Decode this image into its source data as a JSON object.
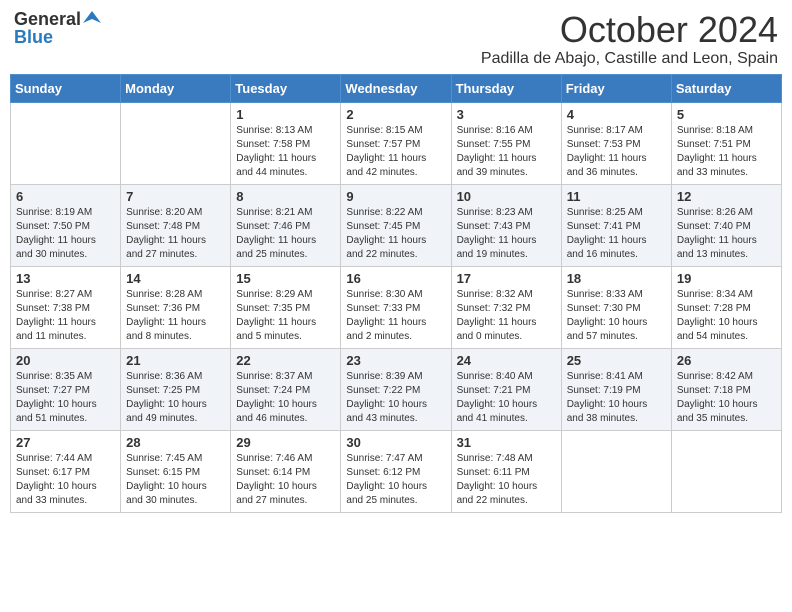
{
  "header": {
    "logo_general": "General",
    "logo_blue": "Blue",
    "month_title": "October 2024",
    "location": "Padilla de Abajo, Castille and Leon, Spain"
  },
  "days_of_week": [
    "Sunday",
    "Monday",
    "Tuesday",
    "Wednesday",
    "Thursday",
    "Friday",
    "Saturday"
  ],
  "weeks": [
    [
      {
        "day": "",
        "text": ""
      },
      {
        "day": "",
        "text": ""
      },
      {
        "day": "1",
        "text": "Sunrise: 8:13 AM\nSunset: 7:58 PM\nDaylight: 11 hours and 44 minutes."
      },
      {
        "day": "2",
        "text": "Sunrise: 8:15 AM\nSunset: 7:57 PM\nDaylight: 11 hours and 42 minutes."
      },
      {
        "day": "3",
        "text": "Sunrise: 8:16 AM\nSunset: 7:55 PM\nDaylight: 11 hours and 39 minutes."
      },
      {
        "day": "4",
        "text": "Sunrise: 8:17 AM\nSunset: 7:53 PM\nDaylight: 11 hours and 36 minutes."
      },
      {
        "day": "5",
        "text": "Sunrise: 8:18 AM\nSunset: 7:51 PM\nDaylight: 11 hours and 33 minutes."
      }
    ],
    [
      {
        "day": "6",
        "text": "Sunrise: 8:19 AM\nSunset: 7:50 PM\nDaylight: 11 hours and 30 minutes."
      },
      {
        "day": "7",
        "text": "Sunrise: 8:20 AM\nSunset: 7:48 PM\nDaylight: 11 hours and 27 minutes."
      },
      {
        "day": "8",
        "text": "Sunrise: 8:21 AM\nSunset: 7:46 PM\nDaylight: 11 hours and 25 minutes."
      },
      {
        "day": "9",
        "text": "Sunrise: 8:22 AM\nSunset: 7:45 PM\nDaylight: 11 hours and 22 minutes."
      },
      {
        "day": "10",
        "text": "Sunrise: 8:23 AM\nSunset: 7:43 PM\nDaylight: 11 hours and 19 minutes."
      },
      {
        "day": "11",
        "text": "Sunrise: 8:25 AM\nSunset: 7:41 PM\nDaylight: 11 hours and 16 minutes."
      },
      {
        "day": "12",
        "text": "Sunrise: 8:26 AM\nSunset: 7:40 PM\nDaylight: 11 hours and 13 minutes."
      }
    ],
    [
      {
        "day": "13",
        "text": "Sunrise: 8:27 AM\nSunset: 7:38 PM\nDaylight: 11 hours and 11 minutes."
      },
      {
        "day": "14",
        "text": "Sunrise: 8:28 AM\nSunset: 7:36 PM\nDaylight: 11 hours and 8 minutes."
      },
      {
        "day": "15",
        "text": "Sunrise: 8:29 AM\nSunset: 7:35 PM\nDaylight: 11 hours and 5 minutes."
      },
      {
        "day": "16",
        "text": "Sunrise: 8:30 AM\nSunset: 7:33 PM\nDaylight: 11 hours and 2 minutes."
      },
      {
        "day": "17",
        "text": "Sunrise: 8:32 AM\nSunset: 7:32 PM\nDaylight: 11 hours and 0 minutes."
      },
      {
        "day": "18",
        "text": "Sunrise: 8:33 AM\nSunset: 7:30 PM\nDaylight: 10 hours and 57 minutes."
      },
      {
        "day": "19",
        "text": "Sunrise: 8:34 AM\nSunset: 7:28 PM\nDaylight: 10 hours and 54 minutes."
      }
    ],
    [
      {
        "day": "20",
        "text": "Sunrise: 8:35 AM\nSunset: 7:27 PM\nDaylight: 10 hours and 51 minutes."
      },
      {
        "day": "21",
        "text": "Sunrise: 8:36 AM\nSunset: 7:25 PM\nDaylight: 10 hours and 49 minutes."
      },
      {
        "day": "22",
        "text": "Sunrise: 8:37 AM\nSunset: 7:24 PM\nDaylight: 10 hours and 46 minutes."
      },
      {
        "day": "23",
        "text": "Sunrise: 8:39 AM\nSunset: 7:22 PM\nDaylight: 10 hours and 43 minutes."
      },
      {
        "day": "24",
        "text": "Sunrise: 8:40 AM\nSunset: 7:21 PM\nDaylight: 10 hours and 41 minutes."
      },
      {
        "day": "25",
        "text": "Sunrise: 8:41 AM\nSunset: 7:19 PM\nDaylight: 10 hours and 38 minutes."
      },
      {
        "day": "26",
        "text": "Sunrise: 8:42 AM\nSunset: 7:18 PM\nDaylight: 10 hours and 35 minutes."
      }
    ],
    [
      {
        "day": "27",
        "text": "Sunrise: 7:44 AM\nSunset: 6:17 PM\nDaylight: 10 hours and 33 minutes."
      },
      {
        "day": "28",
        "text": "Sunrise: 7:45 AM\nSunset: 6:15 PM\nDaylight: 10 hours and 30 minutes."
      },
      {
        "day": "29",
        "text": "Sunrise: 7:46 AM\nSunset: 6:14 PM\nDaylight: 10 hours and 27 minutes."
      },
      {
        "day": "30",
        "text": "Sunrise: 7:47 AM\nSunset: 6:12 PM\nDaylight: 10 hours and 25 minutes."
      },
      {
        "day": "31",
        "text": "Sunrise: 7:48 AM\nSunset: 6:11 PM\nDaylight: 10 hours and 22 minutes."
      },
      {
        "day": "",
        "text": ""
      },
      {
        "day": "",
        "text": ""
      }
    ]
  ]
}
